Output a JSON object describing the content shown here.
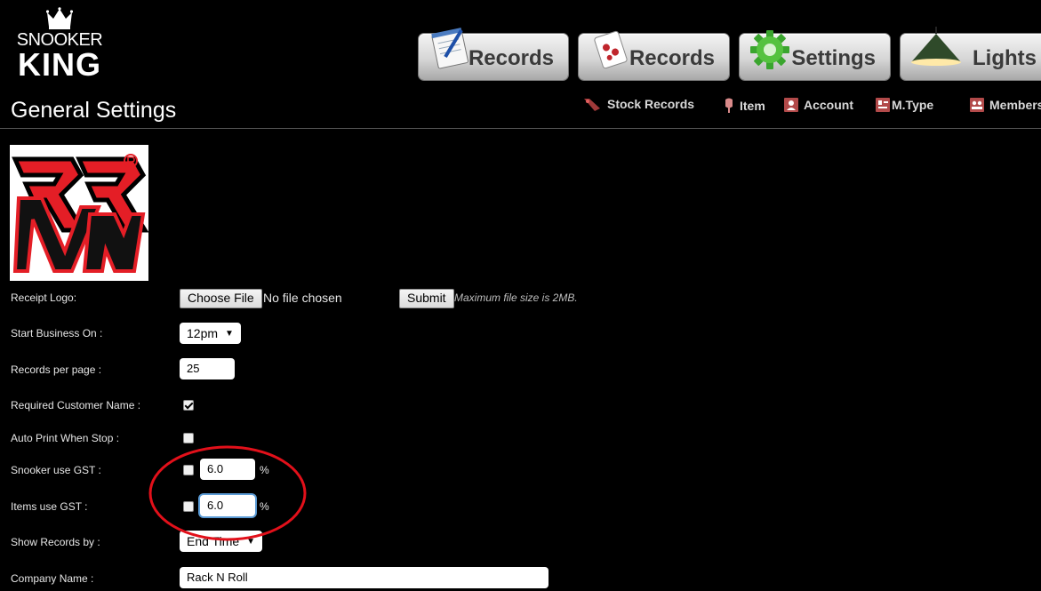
{
  "brand": {
    "line1": "SNOOKER",
    "line2": "KING"
  },
  "tabs": [
    {
      "label": "Records",
      "icon": "notepad-pen-icon"
    },
    {
      "label": "Records",
      "icon": "cards-icon"
    },
    {
      "label": "Settings",
      "icon": "gear-icon"
    },
    {
      "label": "Lights",
      "icon": "lamp-icon"
    }
  ],
  "subnav": [
    {
      "label": "Stock Records",
      "icon": "stock-icon"
    },
    {
      "label": "Item",
      "icon": "pin-icon"
    },
    {
      "label": "Account",
      "icon": "account-icon"
    },
    {
      "label": "M.Type",
      "icon": "card-icon"
    },
    {
      "label": "Members",
      "icon": "members-icon"
    }
  ],
  "page": {
    "title": "General Settings"
  },
  "form": {
    "receipt_logo": {
      "label": "Receipt Logo:",
      "choose_label": "Choose File",
      "no_file": "No file chosen",
      "submit_label": "Submit",
      "hint": "Maximum file size is 2MB."
    },
    "start_business": {
      "label": "Start Business On :",
      "value": "12pm"
    },
    "records_per_page": {
      "label": "Records per page :",
      "value": "25"
    },
    "required_customer": {
      "label": "Required Customer Name :",
      "checked": true
    },
    "auto_print": {
      "label": "Auto Print When Stop :",
      "checked": false
    },
    "snooker_gst": {
      "label": "Snooker use GST :",
      "checked": false,
      "value": "6.0",
      "unit": "%"
    },
    "items_gst": {
      "label": "Items use GST :",
      "checked": false,
      "value": "6.0",
      "unit": "%"
    },
    "show_records_by": {
      "label": "Show Records by :",
      "value": "End Time"
    },
    "company_name": {
      "label": "Company Name :",
      "value": "Rack N Roll"
    }
  },
  "colors": {
    "background": "#000000",
    "annotation": "#e2101a",
    "logo_red": "#e41e26"
  }
}
